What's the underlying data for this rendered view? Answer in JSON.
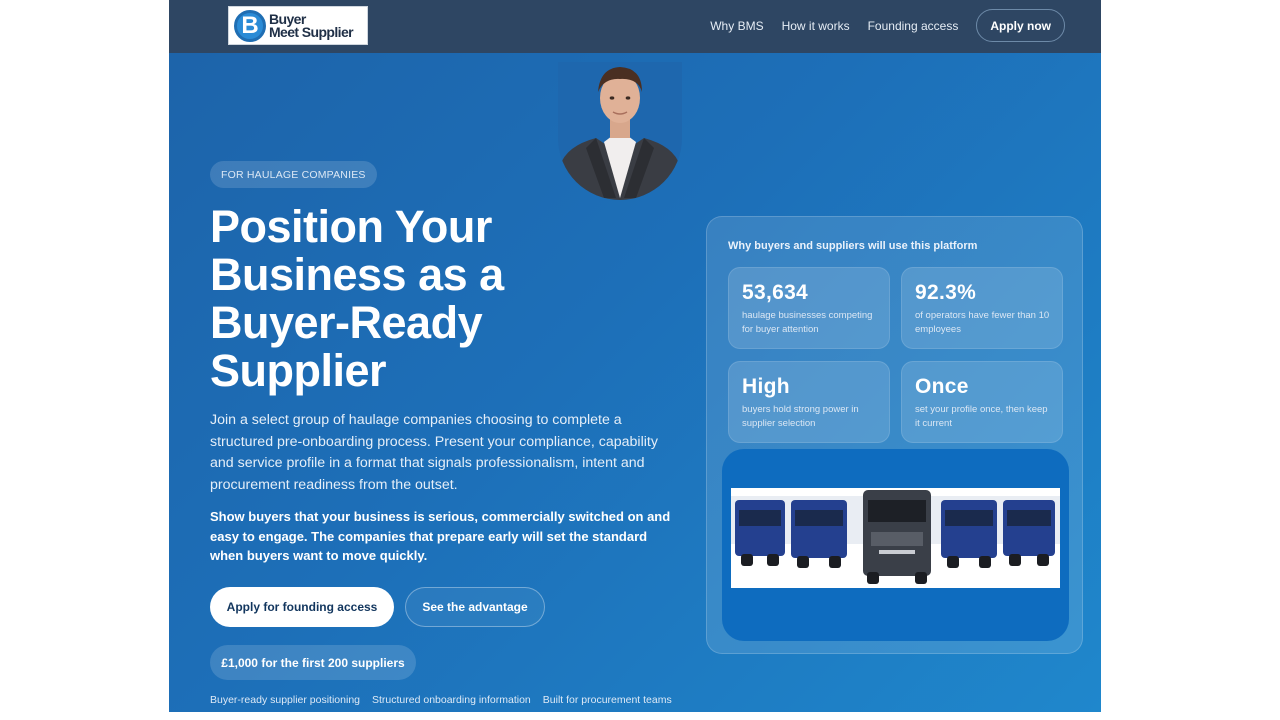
{
  "header": {
    "logo": {
      "mark": "B",
      "line1": "Buyer",
      "line2": "Meet Supplier"
    },
    "nav": [
      {
        "label": "Why BMS"
      },
      {
        "label": "How it works"
      },
      {
        "label": "Founding access"
      }
    ],
    "apply_now_label": "Apply now"
  },
  "hero": {
    "eyebrow": "FOR HAULAGE COMPANIES",
    "headline": "Position Your Business as a Buyer-Ready Supplier",
    "intro": "Join a select group of haulage companies choosing to complete a structured pre-onboarding process. Present your compliance, capability and service profile in a format that signals professionalism, intent and procurement readiness from the outset.",
    "emphasis": "Show buyers that your business is serious, commercially switched on and easy to engage. The companies that prepare early will set the standard when buyers want to move quickly.",
    "primary_cta": "Apply for founding access",
    "secondary_cta": "See the advantage",
    "price_badge": "£1,000 for the first 200 suppliers",
    "features": [
      "Buyer-ready supplier positioning",
      "Structured onboarding information",
      "Built for procurement teams"
    ]
  },
  "panel": {
    "title": "Why buyers and suppliers will use this platform",
    "stats": [
      {
        "value": "53,634",
        "desc": "haulage businesses competing for buyer attention"
      },
      {
        "value": "92.3%",
        "desc": "of operators have fewer than 10 employees"
      },
      {
        "value": "High",
        "desc": "buyers hold strong power in supplier selection"
      },
      {
        "value": "Once",
        "desc": "set your profile once, then keep it current"
      }
    ]
  },
  "colors": {
    "topbar": "#2e4663",
    "hero_start": "#1d63a9",
    "hero_end": "#1f87cc",
    "truck_blue": "#24408f"
  }
}
